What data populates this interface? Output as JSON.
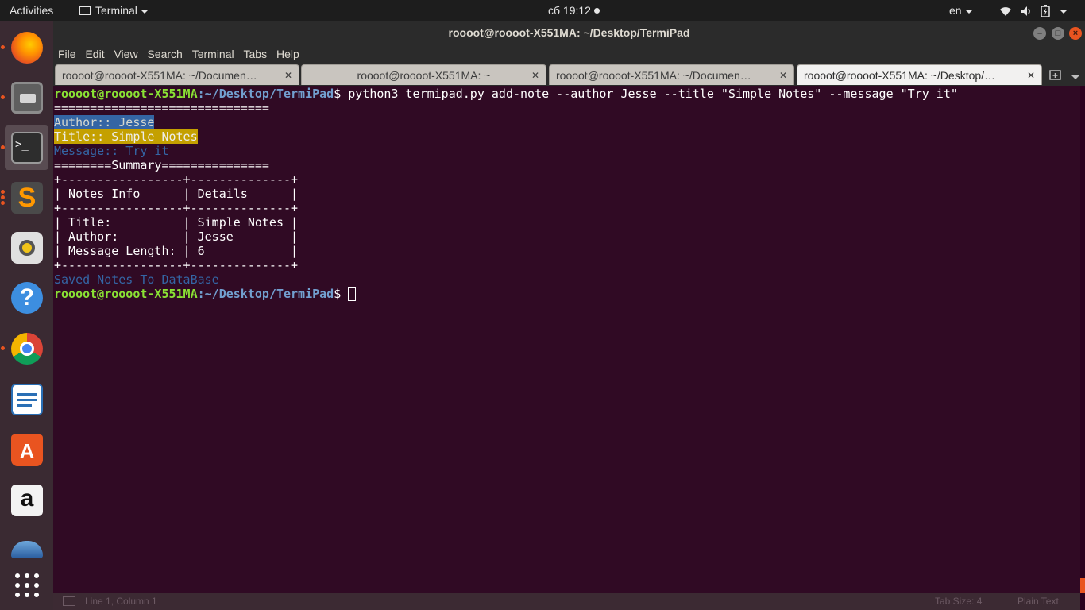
{
  "topbar": {
    "activities": "Activities",
    "app_menu": "Terminal",
    "clock": "сб 19:12",
    "language": "en"
  },
  "window": {
    "title": "roooot@roooot-X551MA: ~/Desktop/TermiPad"
  },
  "menu": [
    "File",
    "Edit",
    "View",
    "Search",
    "Terminal",
    "Tabs",
    "Help"
  ],
  "tabs": [
    {
      "label": "roooot@roooot-X551MA: ~/Documen…",
      "active": false
    },
    {
      "label": "roooot@roooot-X551MA: ~",
      "active": false
    },
    {
      "label": "roooot@roooot-X551MA: ~/Documen…",
      "active": false
    },
    {
      "label": "roooot@roooot-X551MA: ~/Desktop/…",
      "active": true
    }
  ],
  "terminal": {
    "prompt_user": "roooot@roooot-X551MA",
    "prompt_path": ":~/Desktop/TermiPad",
    "prompt_sym": "$",
    "command": " python3 termipad.py add-note --author Jesse --title \"Simple Notes\" --message \"Try it\"",
    "sep1": "==============================",
    "author_line": "Author:: Jesse",
    "title_line": "Title:: Simple Notes",
    "message_line": "Message:: Try it",
    "summary_line": "========Summary===============",
    "table_border": "+-----------------+--------------+",
    "table_header": "| Notes Info      | Details      |",
    "table_rows": [
      "| Title:          | Simple Notes |",
      "| Author:         | Jesse        |",
      "| Message Length: | 6            |"
    ],
    "saved_line": "Saved Notes To DataBase"
  },
  "statusbar": {
    "position": "Line 1, Column 1",
    "tab_size": "Tab Size: 4",
    "syntax": "Plain Text"
  },
  "colors": {
    "terminal_bg": "#300a24",
    "prompt_user": "#8ae234",
    "prompt_path": "#729fcf",
    "accent": "#e95420"
  },
  "dock_icons": [
    "firefox-icon",
    "files-icon",
    "terminal-icon",
    "sublime-text-icon",
    "rhythmbox-icon",
    "help-icon",
    "chrome-icon",
    "writer-icon",
    "software-center-icon",
    "amazon-icon",
    "thunderbird-icon",
    "app-grid-icon"
  ]
}
